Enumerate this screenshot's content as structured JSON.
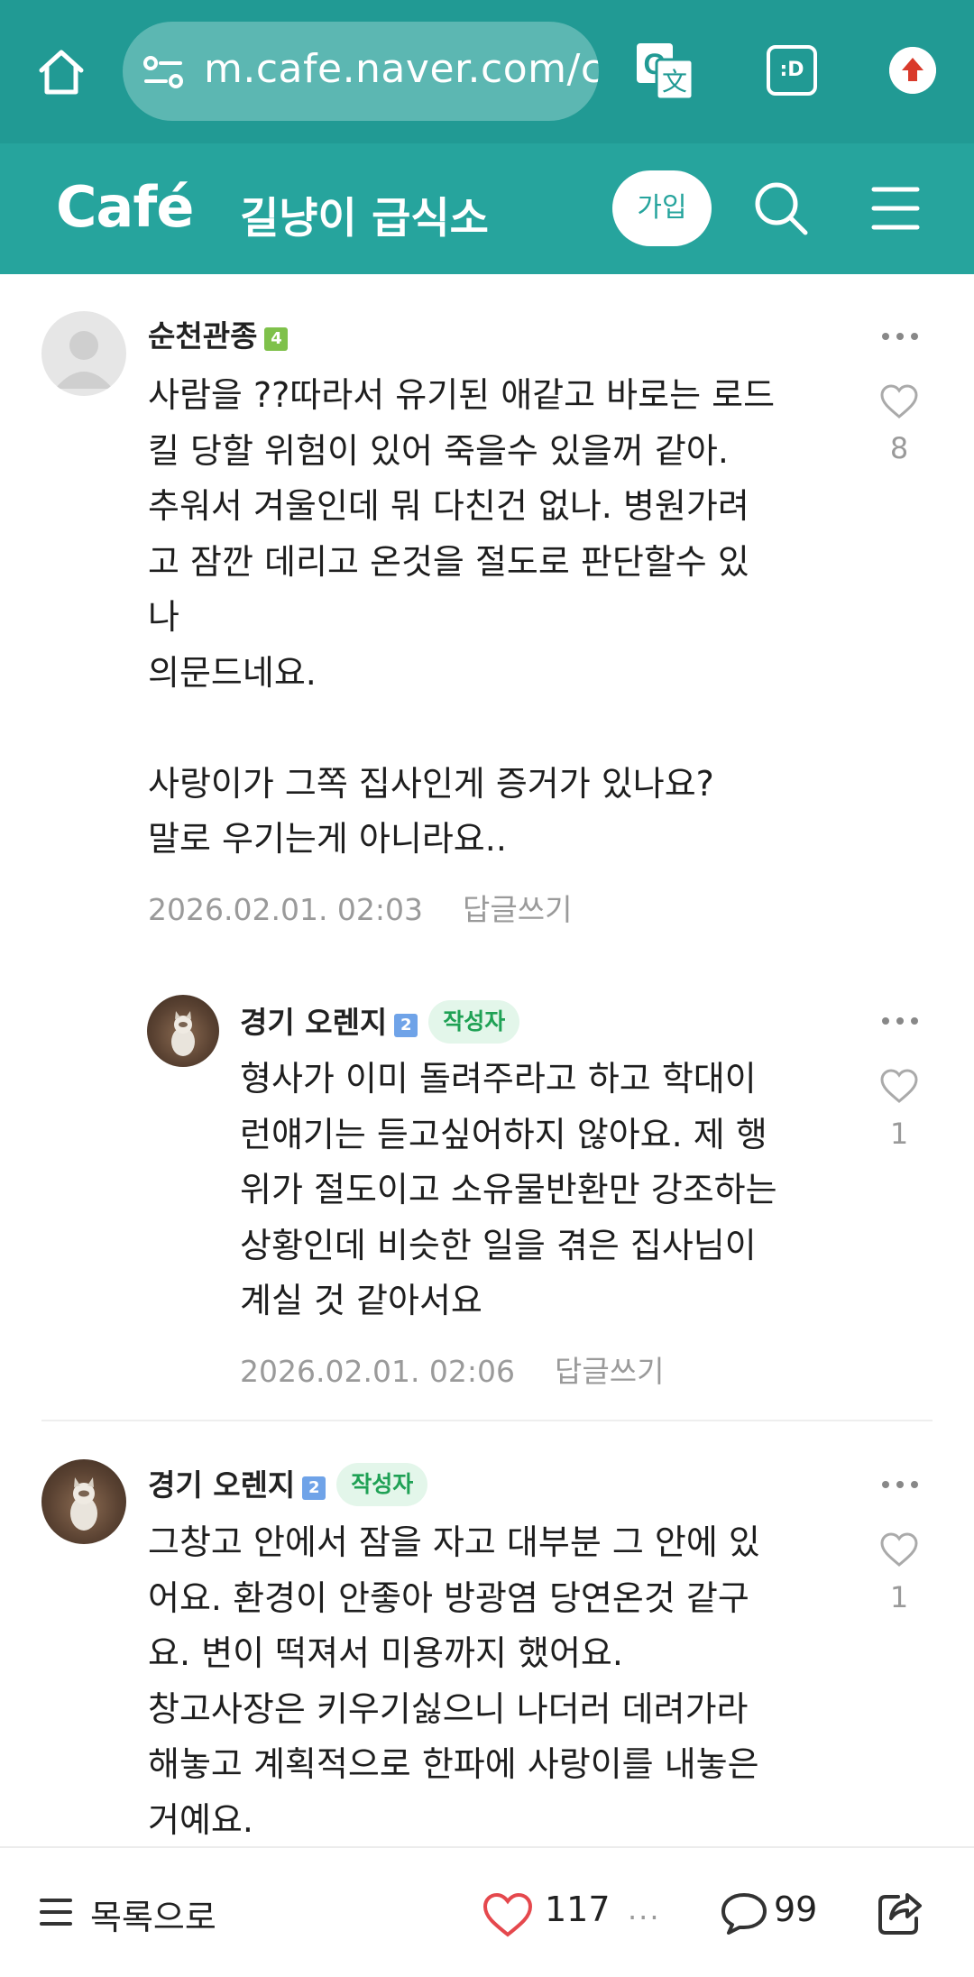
{
  "browser": {
    "url": "m.cafe.naver.com/c",
    "tab_label": ":D"
  },
  "header": {
    "logo": "Café",
    "cafe_name": "길냥이 급식소",
    "join_label": "가입"
  },
  "comments": [
    {
      "author": "순천관종",
      "level": "4",
      "is_writer": false,
      "lines": [
        "사람을 ??따라서 유기된 애같고 바로는 로드",
        "킬 당할 위험이 있어 죽을수 있을꺼 같아.",
        "추워서 겨울인데 뭐 다친건 없나. 병원가려",
        "고 잠깐 데리고 온것을 절도로 판단할수 있",
        "나",
        "의문드네요.",
        "",
        "사랑이가 그쪽 집사인게 증거가 있나요?",
        "말로 우기는게 아니라요.."
      ],
      "timestamp": "2026.02.01. 02:03",
      "reply_label": "답글쓰기",
      "likes": "8"
    },
    {
      "author": "경기 오렌지",
      "level": "2",
      "is_writer": true,
      "writer_tag": "작성자",
      "lines": [
        "형사가 이미 돌려주라고 하고 학대이",
        "런얘기는 듣고싶어하지 않아요. 제 행",
        "위가 절도이고 소유물반환만 강조하는",
        "상황인데 비슷한 일을 겪은 집사님이",
        "계실 것 같아서요"
      ],
      "timestamp": "2026.02.01. 02:06",
      "reply_label": "답글쓰기",
      "likes": "1"
    },
    {
      "author": "경기 오렌지",
      "level": "2",
      "is_writer": true,
      "writer_tag": "작성자",
      "lines": [
        "그창고 안에서 잠을 자고 대부분 그 안에 있",
        "어요. 환경이 안좋아 방광염 당연온것 같구",
        "요. 변이 떡져서 미용까지 했어요.",
        "창고사장은 키우기싫으니 나더러 데려가라",
        "해놓고 계획적으로 한파에 사랑이를 내놓은",
        "거예요."
      ],
      "likes": "1"
    }
  ],
  "bottom_bar": {
    "list_label": "목록으로",
    "like_count": "117",
    "comment_count": "99"
  },
  "colors": {
    "browser_bar": "#219a94",
    "cafe_header": "#26a49d",
    "writer_tag_bg": "#e3f6ea",
    "writer_tag_text": "#1fa155",
    "like_red": "#e5484d"
  }
}
